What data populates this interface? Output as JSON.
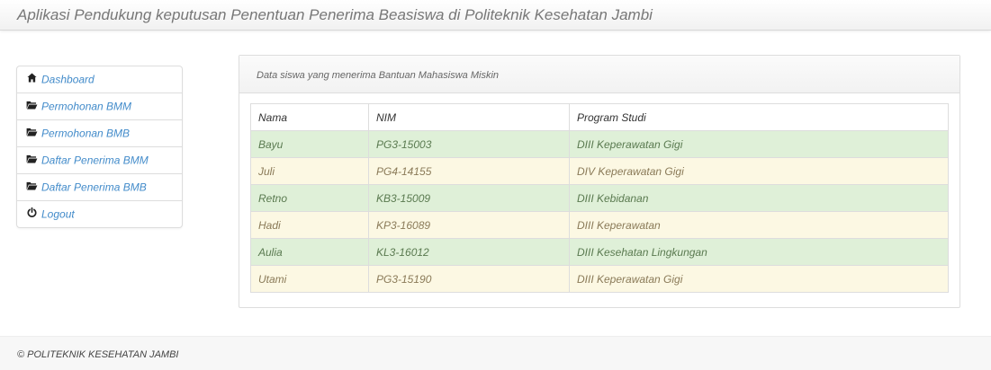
{
  "header": {
    "title": "Aplikasi Pendukung keputusan Penentuan Penerima Beasiswa di Politeknik Kesehatan Jambi"
  },
  "sidebar": {
    "items": [
      {
        "label": "Dashboard",
        "icon": "home-icon"
      },
      {
        "label": "Permohonan BMM",
        "icon": "folder-open-icon"
      },
      {
        "label": "Permohonan BMB",
        "icon": "folder-open-icon"
      },
      {
        "label": "Daftar Penerima BMM",
        "icon": "folder-open-icon"
      },
      {
        "label": "Daftar Penerima BMB",
        "icon": "folder-open-icon"
      },
      {
        "label": "Logout",
        "icon": "power-icon"
      }
    ]
  },
  "panel": {
    "heading": "Data siswa yang menerima Bantuan Mahasiswa Miskin",
    "columns": [
      "Nama",
      "NIM",
      "Program Studi"
    ],
    "rows": [
      {
        "nama": "Bayu",
        "nim": "PG3-15003",
        "prodi": "DIII Keperawatan Gigi",
        "status": "success"
      },
      {
        "nama": "Juli",
        "nim": "PG4-14155",
        "prodi": "DIV Keperawatan Gigi",
        "status": "warning"
      },
      {
        "nama": "Retno",
        "nim": "KB3-15009",
        "prodi": "DIII Kebidanan",
        "status": "success"
      },
      {
        "nama": "Hadi",
        "nim": "KP3-16089",
        "prodi": "DIII Keperawatan",
        "status": "warning"
      },
      {
        "nama": "Aulia",
        "nim": "KL3-16012",
        "prodi": "DIII Kesehatan Lingkungan",
        "status": "success"
      },
      {
        "nama": "Utami",
        "nim": "PG3-15190",
        "prodi": "DIII Keperawatan Gigi",
        "status": "warning"
      }
    ]
  },
  "footer": {
    "text": "© POLITEKNIK KESEHATAN JAMBI"
  },
  "colors": {
    "link": "#428bca",
    "success_row": "#dff0d8",
    "warning_row": "#fcf8e3"
  }
}
